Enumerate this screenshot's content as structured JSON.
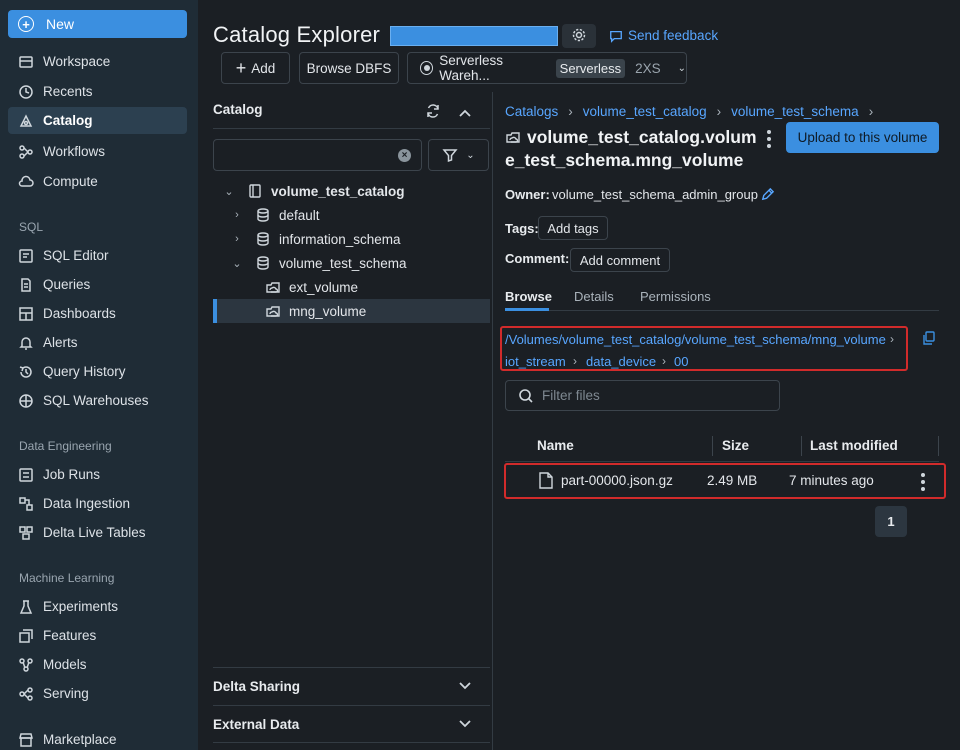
{
  "nav": {
    "new_label": "New",
    "items_top": [
      {
        "label": "Workspace",
        "icon": "workspace-icon"
      },
      {
        "label": "Recents",
        "icon": "clock-icon"
      },
      {
        "label": "Catalog",
        "icon": "catalog-icon",
        "active": true
      },
      {
        "label": "Workflows",
        "icon": "workflows-icon"
      },
      {
        "label": "Compute",
        "icon": "cloud-icon"
      }
    ],
    "sql_section": "SQL",
    "items_sql": [
      {
        "label": "SQL Editor",
        "icon": "sql-editor-icon"
      },
      {
        "label": "Queries",
        "icon": "queries-icon"
      },
      {
        "label": "Dashboards",
        "icon": "dashboards-icon"
      },
      {
        "label": "Alerts",
        "icon": "bell-icon"
      },
      {
        "label": "Query History",
        "icon": "history-icon"
      },
      {
        "label": "SQL Warehouses",
        "icon": "warehouse-icon"
      }
    ],
    "de_section": "Data Engineering",
    "items_de": [
      {
        "label": "Job Runs",
        "icon": "job-runs-icon"
      },
      {
        "label": "Data Ingestion",
        "icon": "ingestion-icon"
      },
      {
        "label": "Delta Live Tables",
        "icon": "dlt-icon"
      }
    ],
    "ml_section": "Machine Learning",
    "items_ml": [
      {
        "label": "Experiments",
        "icon": "flask-icon"
      },
      {
        "label": "Features",
        "icon": "features-icon"
      },
      {
        "label": "Models",
        "icon": "models-icon"
      },
      {
        "label": "Serving",
        "icon": "serving-icon"
      }
    ],
    "items_bottom": [
      {
        "label": "Marketplace",
        "icon": "marketplace-icon"
      }
    ]
  },
  "header": {
    "title": "Catalog Explorer",
    "feedback": "Send feedback",
    "add_label": "Add",
    "browse_dbfs_label": "Browse DBFS",
    "warehouse_name": "Serverless Wareh...",
    "warehouse_type": "Serverless",
    "warehouse_size": "2XS"
  },
  "catalog_panel": {
    "heading": "Catalog",
    "search_value": "",
    "tree": [
      {
        "label": "volume_test_catalog",
        "level": 0,
        "expanded": true,
        "icon": "catalog-book-icon"
      },
      {
        "label": "default",
        "level": 1,
        "expanded": false,
        "icon": "database-icon"
      },
      {
        "label": "information_schema",
        "level": 1,
        "expanded": false,
        "icon": "database-icon"
      },
      {
        "label": "volume_test_schema",
        "level": 1,
        "expanded": true,
        "icon": "database-icon"
      },
      {
        "label": "ext_volume",
        "level": 2,
        "icon": "volume-icon"
      },
      {
        "label": "mng_volume",
        "level": 2,
        "icon": "volume-icon",
        "selected": true
      }
    ],
    "delta_sharing": "Delta Sharing",
    "external_data": "External Data"
  },
  "detail": {
    "breadcrumb": [
      "Catalogs",
      "volume_test_catalog",
      "volume_test_schema"
    ],
    "title_line1": "volume_test_catalog.volum",
    "title_line2": "e_test_schema.mng_volume",
    "upload_label": "Upload to this volume",
    "owner_label": "Owner:",
    "owner_value": "volume_test_schema_admin_group",
    "tags_label": "Tags:",
    "add_tags_label": "Add tags",
    "comment_label": "Comment:",
    "add_comment_label": "Add comment",
    "tabs": [
      "Browse",
      "Details",
      "Permissions"
    ],
    "path_root": "/Volumes/volume_test_catalog/volume_test_schema/mng_volume",
    "path_parts": [
      "iot_stream",
      "data_device",
      "00"
    ],
    "filter_placeholder": "Filter files",
    "columns": [
      "Name",
      "Size",
      "Last modified"
    ],
    "files": [
      {
        "name": "part-00000.json.gz",
        "size": "2.49 MB",
        "modified": "7 minutes ago"
      }
    ],
    "page": "1"
  }
}
